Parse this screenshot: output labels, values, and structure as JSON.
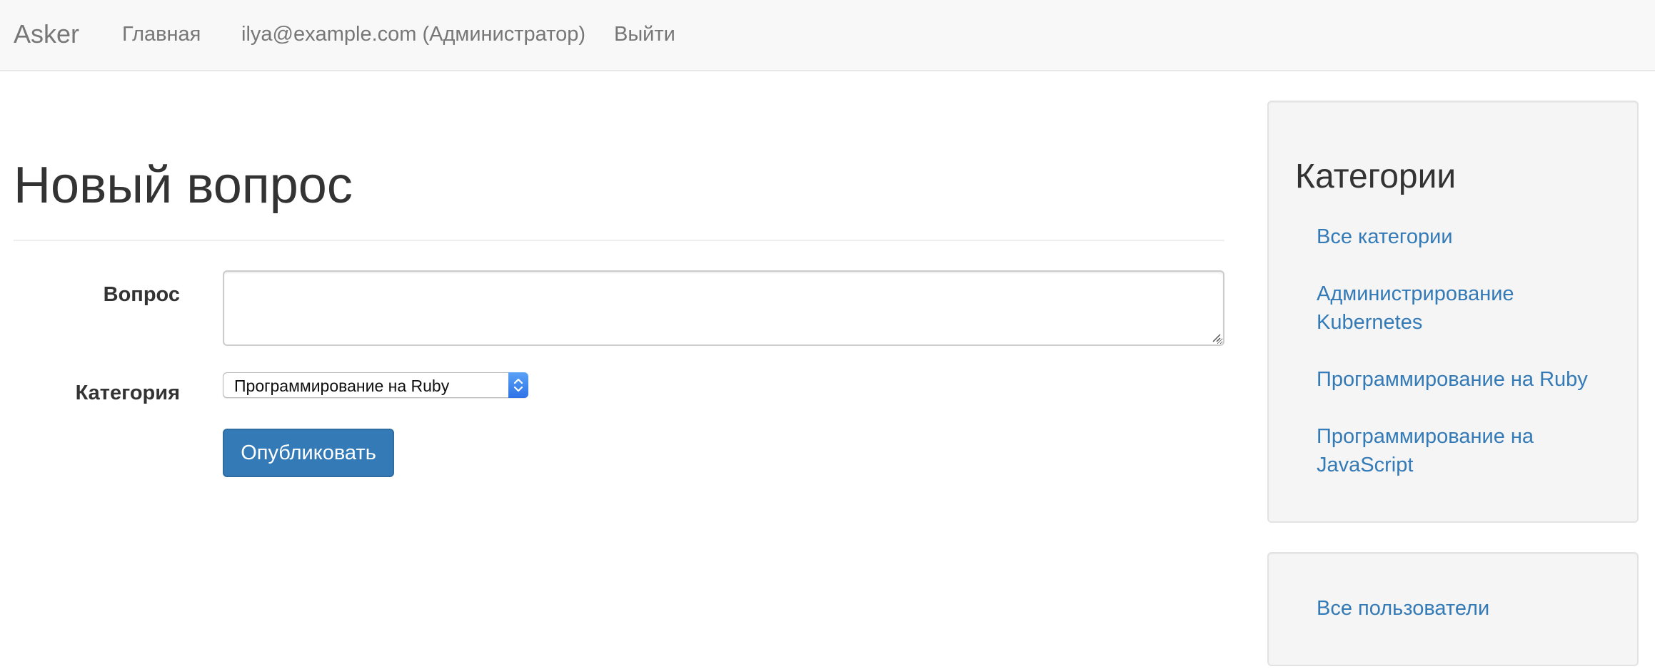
{
  "navbar": {
    "brand": "Asker",
    "home_label": "Главная",
    "user_label": "ilya@example.com (Администратор)",
    "logout_label": "Выйти"
  },
  "main": {
    "title": "Новый вопрос",
    "form": {
      "question_label": "Вопрос",
      "question_value": "",
      "category_label": "Категория",
      "category_selected": "Программирование на Ruby",
      "submit_label": "Опубликовать"
    }
  },
  "sidebar": {
    "categories_title": "Категории",
    "links": [
      "Все категории",
      "Администрирование Kubernetes",
      "Программирование на Ruby",
      "Программирование на JavaScript"
    ],
    "users_link": "Все пользователи"
  },
  "colors": {
    "link": "#337ab7",
    "primary_button": "#337ab7",
    "navbar_bg": "#f8f8f8",
    "well_bg": "#f5f5f5"
  }
}
